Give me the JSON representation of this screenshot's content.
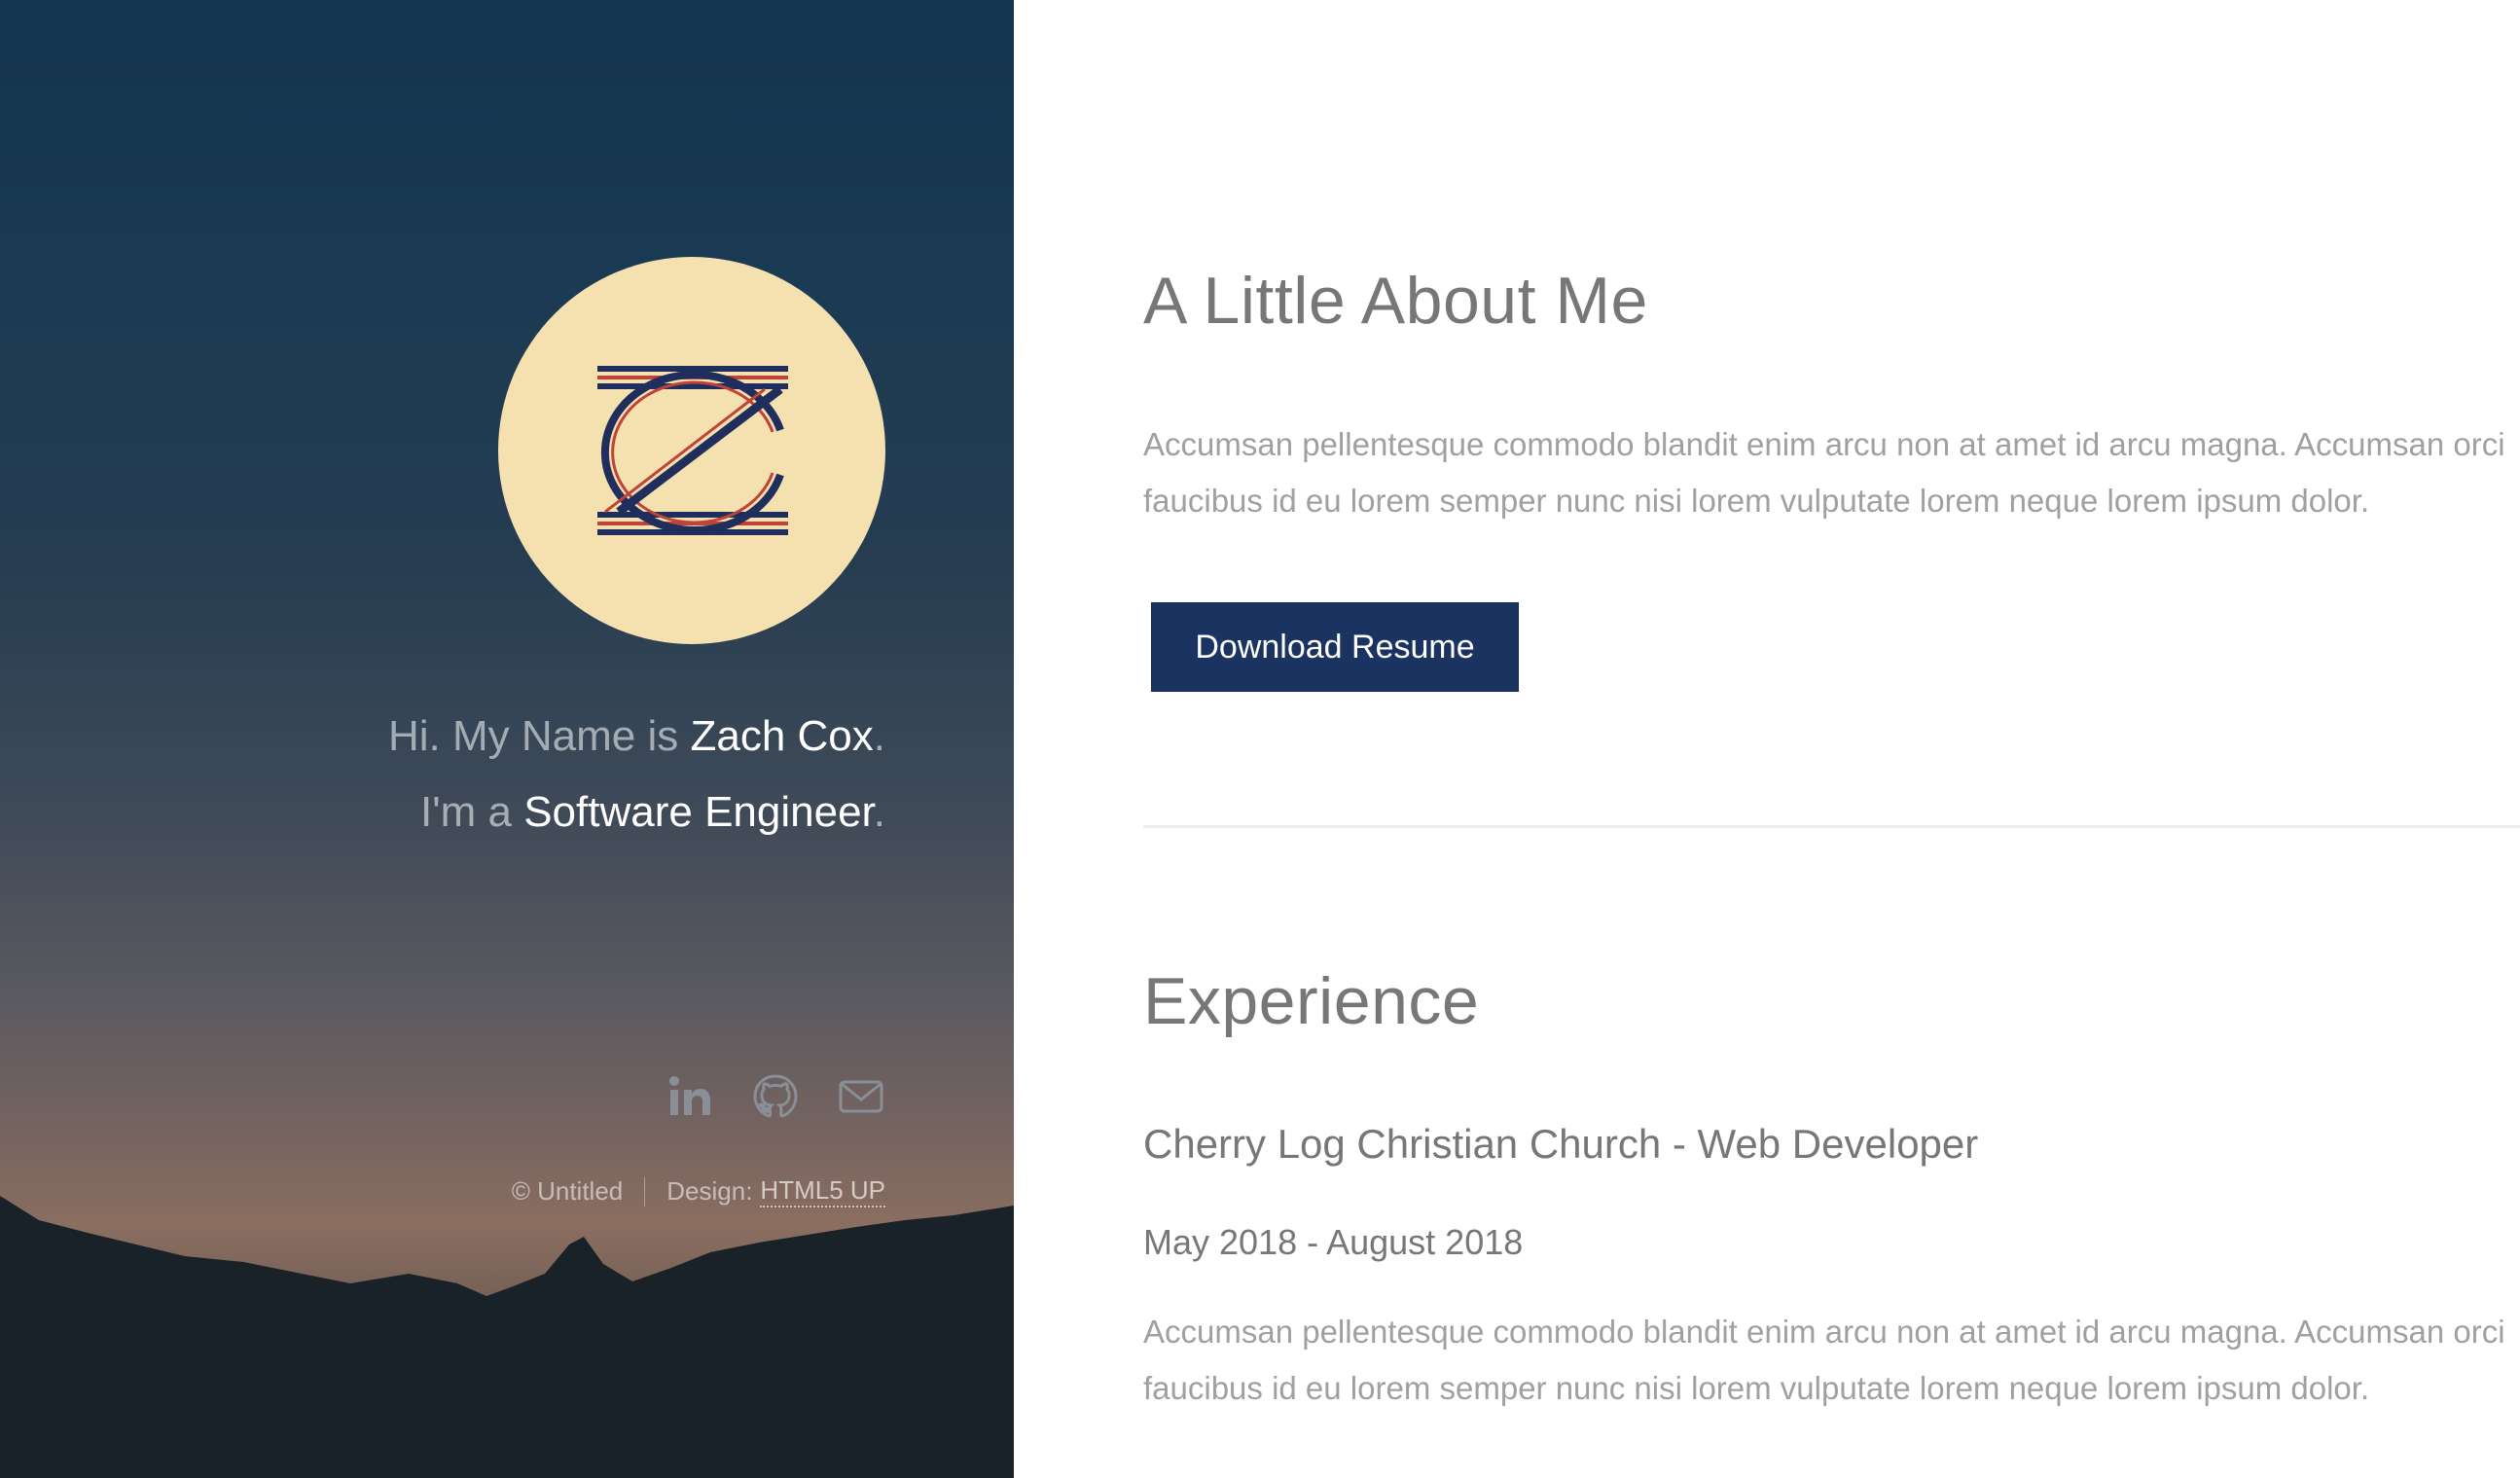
{
  "sidebar": {
    "intro_line1_prefix": "Hi. My Name is ",
    "name": "Zach Cox",
    "intro_line1_suffix": ".",
    "intro_line2_prefix": "I'm a ",
    "role": "Software Engineer",
    "intro_line2_suffix": ".",
    "social": [
      {
        "icon": "linkedin-icon"
      },
      {
        "icon": "github-icon"
      },
      {
        "icon": "envelope-icon"
      }
    ],
    "copyright": "© Untitled",
    "design_label": "Design:",
    "design_link": "HTML5 UP"
  },
  "about": {
    "title": "A Little About Me",
    "text": "Accumsan pellentesque commodo blandit enim arcu non at amet id arcu magna. Accumsan orci faucibus id eu lorem semper nunc nisi lorem vulputate lorem neque lorem ipsum dolor.",
    "button_label": "Download Resume"
  },
  "experience": {
    "title": "Experience",
    "jobs": [
      {
        "title": "Cherry Log Christian Church - Web Developer",
        "dates": "May 2018 - August 2018",
        "description": "Accumsan pellentesque commodo blandit enim arcu non at amet id arcu magna. Accumsan orci faucibus id eu lorem semper nunc nisi lorem vulputate lorem neque lorem ipsum dolor."
      }
    ]
  },
  "colors": {
    "button_bg": "#1b3360",
    "avatar_bg": "#f5e1b0",
    "heading": "#777777",
    "body_text": "#a0a0a0"
  }
}
